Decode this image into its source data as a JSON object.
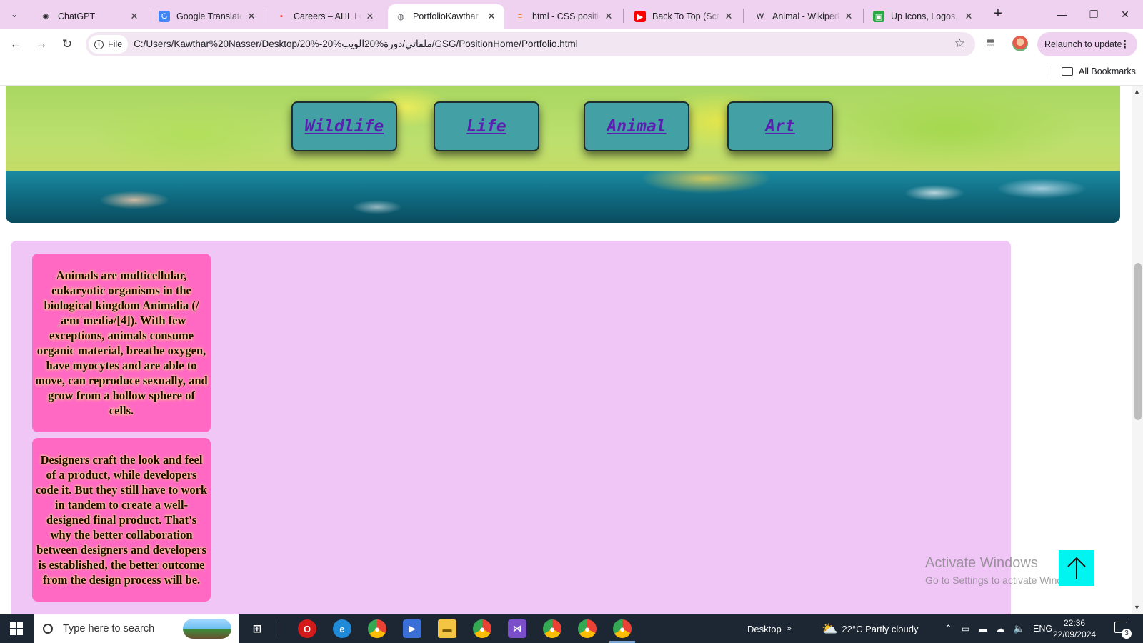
{
  "tabs": [
    {
      "title": "ChatGPT",
      "icon": "chatgpt-icon",
      "glyph": "✺",
      "color": "#202124",
      "bg": "transparent",
      "active": false
    },
    {
      "title": "Google Translate",
      "icon": "google-translate-icon",
      "glyph": "G",
      "color": "#ffffff",
      "bg": "#4285f4",
      "active": false
    },
    {
      "title": "Careers – AHL Log",
      "icon": "ahl-icon",
      "glyph": "▪",
      "color": "#e8453c",
      "bg": "transparent",
      "active": false
    },
    {
      "title": "PortfolioKawthar",
      "icon": "globe-icon",
      "glyph": "◍",
      "color": "#5f6368",
      "bg": "transparent",
      "active": true
    },
    {
      "title": "html - CSS positio",
      "icon": "stackoverflow-icon",
      "glyph": "≡",
      "color": "#f48024",
      "bg": "transparent",
      "active": false
    },
    {
      "title": "Back To Top (Scrol",
      "icon": "youtube-icon",
      "glyph": "▶",
      "color": "#ffffff",
      "bg": "#ff0000",
      "active": false
    },
    {
      "title": "Animal - Wikipedi",
      "icon": "wikipedia-icon",
      "glyph": "W",
      "color": "#202124",
      "bg": "transparent",
      "active": false
    },
    {
      "title": "Up Icons, Logos, S",
      "icon": "icons-site-icon",
      "glyph": "▣",
      "color": "#ffffff",
      "bg": "#28a745",
      "active": false
    }
  ],
  "address": {
    "scheme_label": "File",
    "url": "C:/Users/Kawthar%20Nasser/Desktop/20%-20%ملفاتي/دورة%20الويب/GSG/PositionHome/Portfolio.html",
    "relaunch_label": "Relaunch to update"
  },
  "bookmarks": {
    "all_label": "All Bookmarks"
  },
  "page": {
    "nav_links": [
      "Wildlife",
      "Life",
      "Animal",
      "Art"
    ],
    "cards": [
      "Animals are multicellular, eukaryotic organisms in the biological kingdom Animalia (/ˌænɪˈmeɪliə/[4]). With few exceptions, animals consume organic material, breathe oxygen, have myocytes and are able to move, can reproduce sexually, and grow from a hollow sphere of cells.",
      "Designers craft the look and feel of a product, while developers code it. But they still have to work in tandem to create a well-designed final product. That's why the better collaboration between designers and developers is established, the better outcome from the design process will be."
    ],
    "colors": {
      "content_bg": "#f0c6f7",
      "card_bg": "#ff69c4",
      "nav_bg": "#43a1a6",
      "nav_text": "#5a1fb0",
      "back_to_top": "#00f5f0"
    }
  },
  "watermark": {
    "line1": "Activate Windows",
    "line2": "Go to Settings to activate Windows."
  },
  "taskbar": {
    "search_placeholder": "Type here to search",
    "desktop_label": "Desktop",
    "weather": "22°C  Partly cloudy",
    "language": "ENG",
    "time": "22:36",
    "date": "22/09/2024",
    "notification_count": "3"
  }
}
